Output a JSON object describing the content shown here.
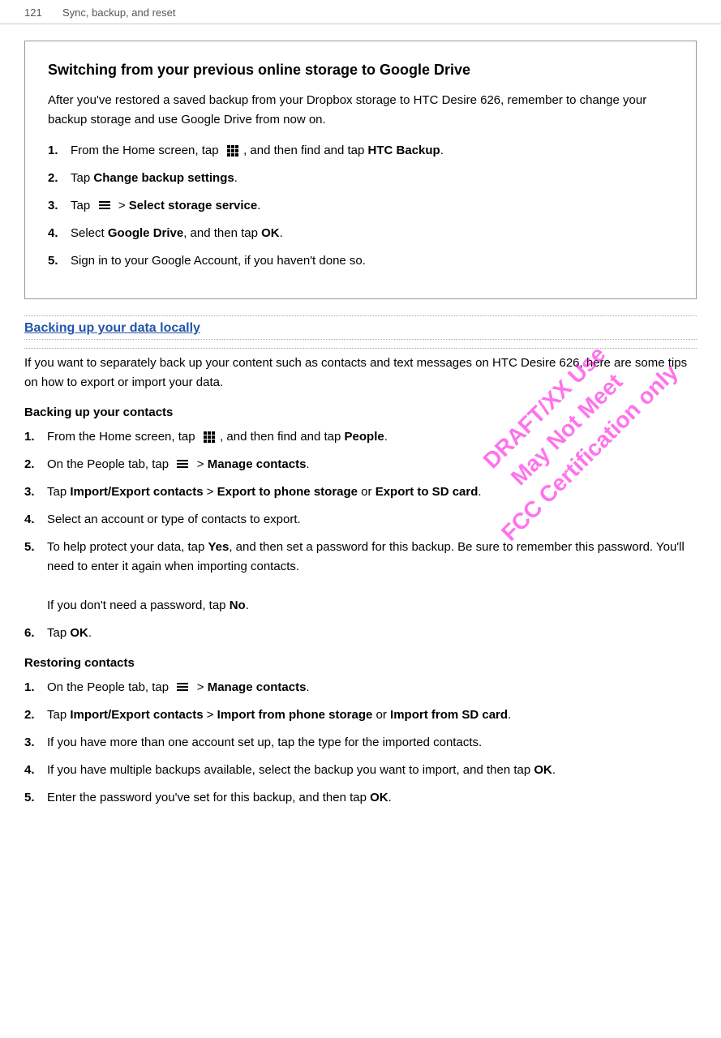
{
  "header": {
    "page_num": "121",
    "chapter": "Sync, backup, and reset"
  },
  "boxed_section": {
    "title": "Switching from your previous online storage to Google Drive",
    "intro": "After you've restored a saved backup from your Dropbox storage to HTC Desire 626, remember to change your backup storage and use Google Drive from now on.",
    "steps": [
      {
        "num": "1.",
        "text_before": "From the Home screen, tap",
        "icon": "grid",
        "text_after": ", and then find and tap",
        "bold_text": "HTC Backup",
        "suffix": "."
      },
      {
        "num": "2.",
        "text_before": "Tap",
        "bold_text": "Change backup settings",
        "suffix": "."
      },
      {
        "num": "3.",
        "text_before": "Tap",
        "icon": "menu",
        "text_after": "> ",
        "bold_text": "Select storage service",
        "suffix": "."
      },
      {
        "num": "4.",
        "text_before": "Select",
        "bold_text1": "Google Drive",
        "text_mid": ", and then tap",
        "bold_text2": "OK",
        "suffix": "."
      },
      {
        "num": "5.",
        "text": "Sign in to your Google Account, if you haven't done so."
      }
    ]
  },
  "backing_section": {
    "heading": "Backing up your data locally",
    "intro": "If you want to separately back up your content such as contacts and text messages on HTC Desire 626, here are some tips on how to export or import your data.",
    "contacts_heading": "Backing up your contacts",
    "contacts_steps": [
      {
        "num": "1.",
        "text_before": "From the Home screen, tap",
        "icon": "grid",
        "text_after": ", and then find and tap",
        "bold_text": "People",
        "suffix": "."
      },
      {
        "num": "2.",
        "text_before": "On the People tab, tap",
        "icon": "menu",
        "text_after": ">",
        "bold_text": "Manage contacts",
        "suffix": "."
      },
      {
        "num": "3.",
        "text_before": "Tap",
        "bold_text1": "Import/Export contacts",
        "text_mid1": " > ",
        "bold_text2": "Export to phone storage",
        "text_mid2": " or ",
        "bold_text3": "Export to SD card",
        "suffix": "."
      },
      {
        "num": "4.",
        "text": "Select an account or type of contacts to export."
      },
      {
        "num": "5.",
        "text_before": "To help protect your data, tap",
        "bold_text1": "Yes",
        "text_mid": ", and then set a password for this backup. Be sure to remember this password. You'll need to enter it again when importing contacts.",
        "sub_text": "If you don't need a password, tap",
        "bold_sub": "No",
        "sub_suffix": "."
      },
      {
        "num": "6.",
        "text_before": "Tap",
        "bold_text": "OK",
        "suffix": "."
      }
    ],
    "restoring_heading": "Restoring contacts",
    "restoring_steps": [
      {
        "num": "1.",
        "text_before": "On the People tab, tap",
        "icon": "menu",
        "text_after": ">",
        "bold_text": "Manage contacts",
        "suffix": "."
      },
      {
        "num": "2.",
        "text_before": "Tap",
        "bold_text1": "Import/Export contacts",
        "text_mid1": " > ",
        "bold_text2": "Import from phone storage",
        "text_mid2": " or ",
        "bold_text3": "Import from SD card",
        "suffix": "."
      },
      {
        "num": "3.",
        "text": "If you have more than one account set up, tap the type for the imported contacts."
      },
      {
        "num": "4.",
        "text": "If you have multiple backups available, select the backup you want to import, and then tap",
        "bold_text": "OK",
        "suffix": "."
      },
      {
        "num": "5.",
        "text_before": "Enter the password you've set for this backup, and then tap",
        "bold_text": "OK",
        "suffix": "."
      }
    ]
  },
  "watermark": {
    "line1": "DRAFT/XX Use",
    "line2": "May Not Meet",
    "line3": "FCC Certification only"
  }
}
